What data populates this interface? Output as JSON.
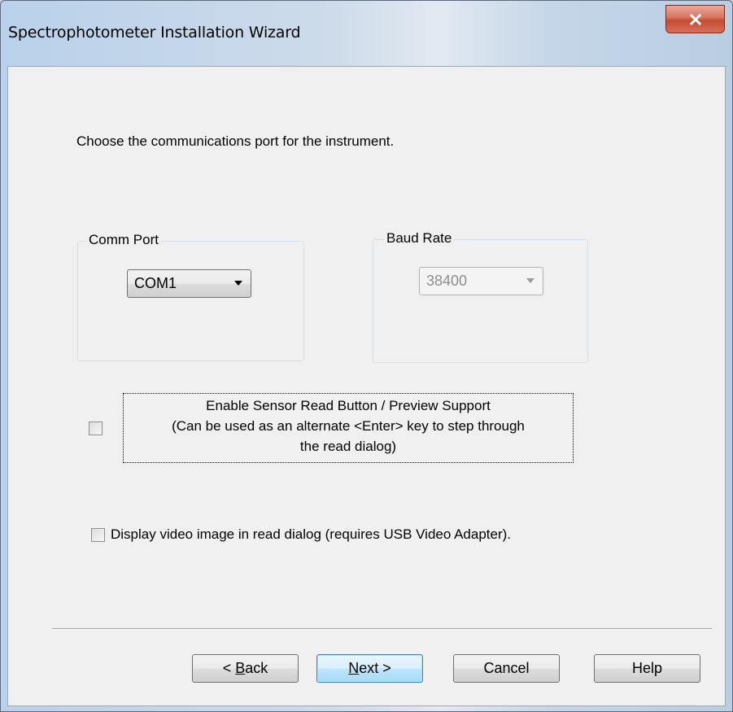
{
  "window": {
    "title": "Spectrophotometer Installation Wizard",
    "close_icon": "close-icon"
  },
  "instruction": "Choose the communications port for the instrument.",
  "comm_port": {
    "legend": "Comm Port",
    "selected": "COM1",
    "enabled": true
  },
  "baud_rate": {
    "legend": "Baud Rate",
    "selected": "38400",
    "enabled": false
  },
  "sensor_option": {
    "checked": false,
    "line1": "Enable Sensor Read Button / Preview Support",
    "line2": "(Can be used as an alternate <Enter> key to step through",
    "line3": "the read dialog)"
  },
  "video_option": {
    "checked": false,
    "label": "Display video image in read dialog (requires USB Video Adapter)."
  },
  "buttons": {
    "back_prefix": "< ",
    "back_mnemonic": "B",
    "back_rest": "ack",
    "next_mnemonic": "N",
    "next_rest": "ext >",
    "cancel": "Cancel",
    "help": "Help"
  },
  "colors": {
    "close_button": "#c64b33",
    "default_button_border": "#3c7fb1",
    "dialog_background": "#f0f0f0"
  }
}
